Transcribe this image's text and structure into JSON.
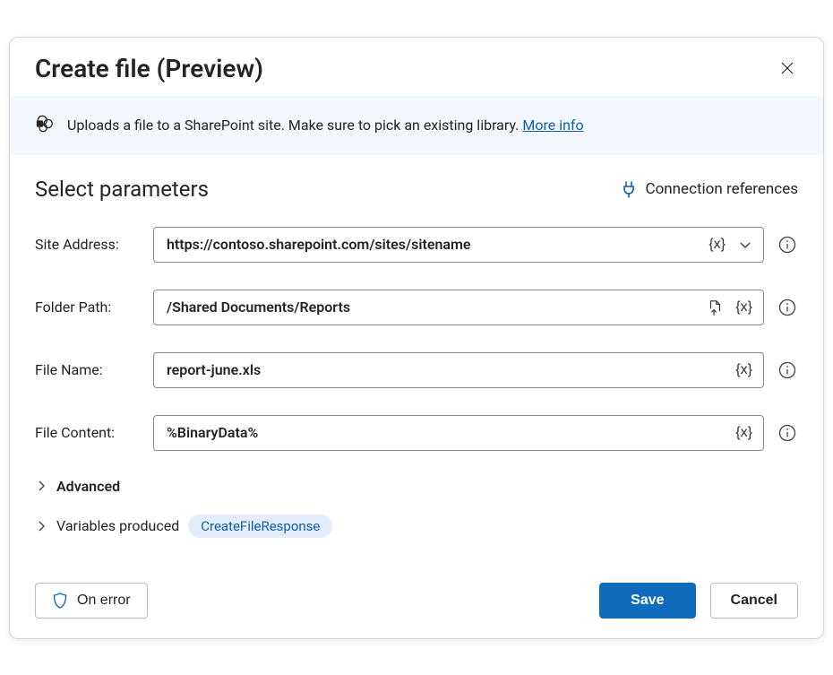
{
  "dialog": {
    "title": "Create file (Preview)"
  },
  "banner": {
    "text": "Uploads a file to a SharePoint site. Make sure to pick an existing library.",
    "link_label": "More info"
  },
  "section": {
    "heading": "Select parameters",
    "connection_ref_label": "Connection references"
  },
  "params": {
    "site_address": {
      "label": "Site Address:",
      "value": "https://contoso.sharepoint.com/sites/sitename",
      "variable_token": "{x}"
    },
    "folder_path": {
      "label": "Folder Path:",
      "value": "/Shared Documents/Reports",
      "variable_token": "{x}"
    },
    "file_name": {
      "label": "File Name:",
      "value": "report-june.xls",
      "variable_token": "{x}"
    },
    "file_content": {
      "label": "File Content:",
      "value": "%BinaryData%",
      "variable_token": "{x}"
    }
  },
  "advanced": {
    "label": "Advanced"
  },
  "variables_produced": {
    "label": "Variables produced",
    "badge": "CreateFileResponse"
  },
  "footer": {
    "on_error_label": "On error",
    "save_label": "Save",
    "cancel_label": "Cancel"
  }
}
